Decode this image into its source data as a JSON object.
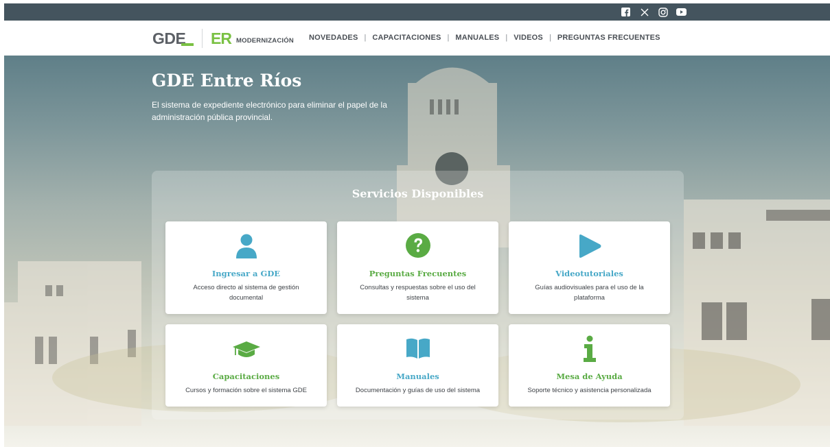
{
  "colors": {
    "topbar": "#44545e",
    "accent_blue": "#47a8c7",
    "accent_green": "#5aab44",
    "brand_green": "#7ac143"
  },
  "social_icons": [
    "facebook-icon",
    "x-icon",
    "instagram-icon",
    "youtube-icon"
  ],
  "header": {
    "logo_gde": "GDE",
    "logo_er": "ER",
    "logo_modernizacion": "MODERNIZACIÓN",
    "nav": [
      {
        "label": "NOVEDADES"
      },
      {
        "label": "CAPACITACIONES"
      },
      {
        "label": "MANUALES"
      },
      {
        "label": "VIDEOS"
      },
      {
        "label": "PREGUNTAS FRECUENTES"
      }
    ],
    "separator": "|"
  },
  "hero": {
    "title": "GDE Entre Ríos",
    "subtitle": "El sistema de expediente electrónico para eliminar el papel de la administración pública provincial."
  },
  "services": {
    "title": "Servicios Disponibles",
    "cards": [
      {
        "icon": "user-icon",
        "title": "Ingresar a GDE",
        "description": "Acceso directo al sistema de gestión documental",
        "color": "blue"
      },
      {
        "icon": "question-circle-icon",
        "title": "Preguntas Frecuentes",
        "description": "Consultas y respuestas sobre el uso del sistema",
        "color": "green"
      },
      {
        "icon": "play-icon",
        "title": "Videotutoriales",
        "description": "Guías audiovisuales para el uso de la plataforma",
        "color": "blue"
      },
      {
        "icon": "graduation-cap-icon",
        "title": "Capacitaciones",
        "description": "Cursos y formación sobre el sistema GDE",
        "color": "green"
      },
      {
        "icon": "book-icon",
        "title": "Manuales",
        "description": "Documentación y guías de uso del sistema",
        "color": "blue"
      },
      {
        "icon": "info-icon",
        "title": "Mesa de Ayuda",
        "description": "Soporte técnico y asistencia personalizada",
        "color": "green"
      }
    ]
  }
}
